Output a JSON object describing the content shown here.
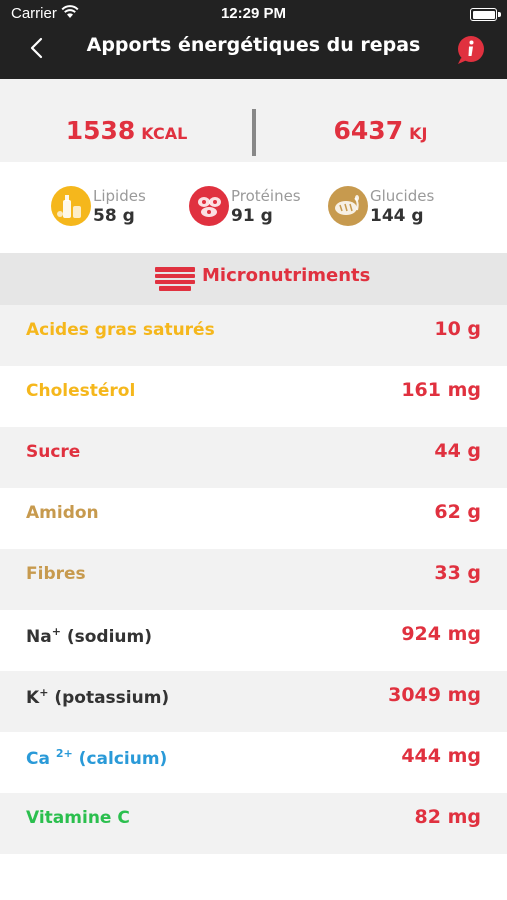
{
  "status_bar": {
    "carrier": "Carrier",
    "time": "12:29 PM"
  },
  "nav": {
    "title": "Apports énergétiques du repas",
    "back_icon": "chevron-left-icon",
    "info_icon": "info-bubble-icon"
  },
  "energy": {
    "kcal": {
      "value": "1538",
      "unit": "KCAL"
    },
    "kj": {
      "value": "6437",
      "unit": "KJ"
    }
  },
  "macros": [
    {
      "label": "Lipides",
      "value": "58 g",
      "icon": "oil-bottle-icon",
      "color": "#f5b71c"
    },
    {
      "label": "Protéines",
      "value": "91 g",
      "icon": "meat-icon",
      "color": "#e0313f"
    },
    {
      "label": "Glucides",
      "value": "144 g",
      "icon": "bread-icon",
      "color": "#c79a4e"
    }
  ],
  "micro": {
    "title": "Micronutriments",
    "icon": "layers-icon"
  },
  "rows": [
    {
      "name": "Acides gras saturés",
      "amount": "10 g",
      "color": "#f5b71c"
    },
    {
      "name": "Cholestérol",
      "amount": "161 mg",
      "color": "#f5b71c"
    },
    {
      "name": "Sucre",
      "amount": "44 g",
      "color": "#e0313f"
    },
    {
      "name": "Amidon",
      "amount": "62 g",
      "color": "#c79a4e"
    },
    {
      "name": "Fibres",
      "amount": "33 g",
      "color": "#c79a4e"
    },
    {
      "name_main": "Na",
      "name_sup": "+",
      "name_rest": " (sodium)",
      "amount": "924 mg",
      "color": "#333333"
    },
    {
      "name_main": "K",
      "name_sup": "+",
      "name_rest": " (potassium)",
      "amount": "3049 mg",
      "color": "#333333"
    },
    {
      "name_main": "Ca ",
      "name_sup": "2+",
      "name_rest": " (calcium)",
      "amount": "444 mg",
      "color": "#2a9ad8"
    },
    {
      "name": "Vitamine C",
      "amount": "82 mg",
      "color": "#2bbf4e"
    }
  ]
}
